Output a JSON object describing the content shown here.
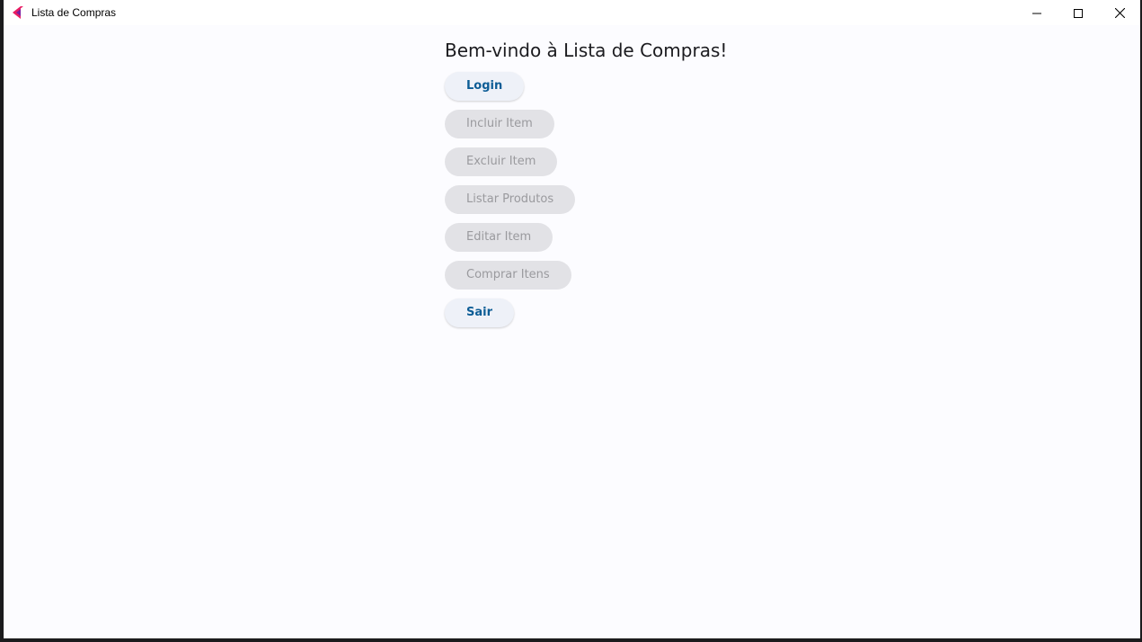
{
  "window": {
    "title": "Lista de Compras",
    "app_icon": "flutter-logo-icon",
    "controls": {
      "minimize_icon": "minimize-icon",
      "maximize_icon": "maximize-icon",
      "close_icon": "close-icon"
    }
  },
  "main": {
    "welcome": "Bem-vindo à Lista de Compras!",
    "buttons": [
      {
        "label": "Login",
        "enabled": true
      },
      {
        "label": "Incluir Item",
        "enabled": false
      },
      {
        "label": "Excluir Item",
        "enabled": false
      },
      {
        "label": "Listar Produtos",
        "enabled": false
      },
      {
        "label": "Editar Item",
        "enabled": false
      },
      {
        "label": "Comprar Itens",
        "enabled": false
      },
      {
        "label": "Sair",
        "enabled": true
      }
    ]
  },
  "colors": {
    "enabled_text": "#0d5d96",
    "disabled_text": "#9a9a9e",
    "enabled_bg": "#eef1f8",
    "disabled_bg": "#e2e2e6",
    "page_bg": "#fcfcff"
  }
}
